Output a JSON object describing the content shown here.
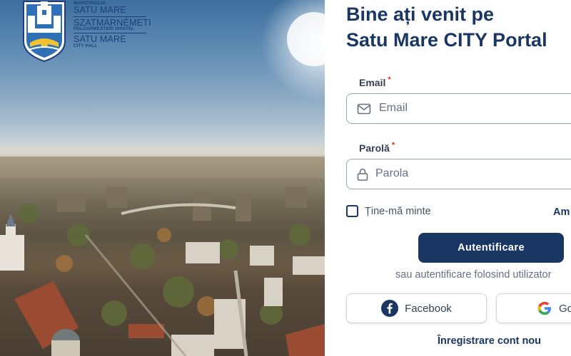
{
  "logo": {
    "line1_small": "MUNICIPIULUI",
    "line1_big": "SATU MARE",
    "line2_big": "SZATMÁRNÉMETI",
    "line2_small": "POLGÁRMESTERI HIVATAL",
    "line3_big": "SATU MARE",
    "line3_small": "CITY HALL"
  },
  "header": {
    "title_line1": "Bine ați venit pe",
    "title_line2": "Satu Mare CITY Portal"
  },
  "form": {
    "email_label": "Email",
    "email_placeholder": "Email",
    "password_label": "Parolă",
    "password_placeholder": "Parola",
    "required_mark": "*",
    "remember_label": "Ține-mă minte",
    "forgot_label": "Am",
    "submit_label": "Autentificare",
    "alt_text": "sau autentificare folosind utilizator",
    "facebook_label": "Facebook",
    "google_label": "Google",
    "register_label": "Înregistrare cont nou"
  },
  "colors": {
    "brand": "#1a3764",
    "required": "#d92d20",
    "facebook": "#1877f2"
  },
  "icons": [
    "crest-icon",
    "mail-icon",
    "lock-icon",
    "facebook-icon",
    "google-icon"
  ]
}
